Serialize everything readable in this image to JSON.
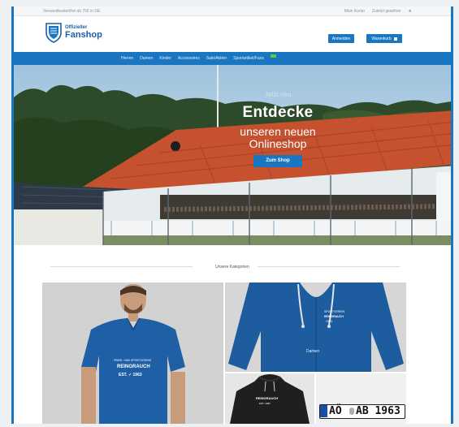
{
  "topbar": {
    "left_text": "Versandkostenfrei ab 75€ in DE",
    "links": [
      "Mein Konto",
      "Zuletzt gesehen",
      "★"
    ]
  },
  "header": {
    "logo_line1": "Offizieller",
    "logo_line2": "Fanshop",
    "button_1": "Anmelden",
    "button_2": "Warenkorb"
  },
  "nav": {
    "items": [
      "Herren",
      "Damen",
      "Kinder",
      "Accessoires",
      "Sale/Aktion",
      "Sportartikel/Fans"
    ]
  },
  "hero": {
    "kicker": "Jetzt neu",
    "title": "Entdecke",
    "subtitle_line1": "unseren neuen",
    "subtitle_line2": "Onlineshop",
    "cta": "Zum Shop"
  },
  "categories": {
    "heading": "Unsere Kategorien",
    "tshirt_print": [
      "FREIE- UND SPORTVEREIN",
      "REINGRAUCH",
      "EST. ✓ 1963"
    ],
    "jacket_print": [
      "SPORTVEREIN",
      "REINGRAUCH",
      "1963"
    ],
    "jacket_label": "Damen",
    "hoodie_print": [
      "REINGRAUCH",
      "EST. 1963"
    ],
    "plate_left": "AÖ",
    "plate_right": "AB 1963"
  },
  "colors": {
    "brand": "#1a76c0",
    "shirt": "#1f5fa6",
    "jacket": "#1d5c9f"
  }
}
